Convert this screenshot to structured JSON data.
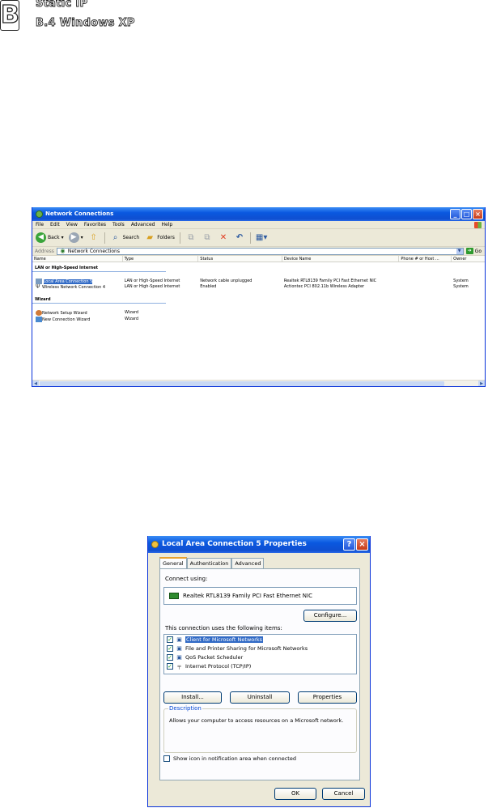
{
  "header": {
    "chapter_letter": "B",
    "title": "Static IP",
    "subtitle": "B.4 Windows XP"
  },
  "network_window": {
    "title": "Network Connections",
    "menu": [
      "File",
      "Edit",
      "View",
      "Favorites",
      "Tools",
      "Advanced",
      "Help"
    ],
    "toolbar": {
      "back": "Back",
      "search": "Search",
      "folders": "Folders"
    },
    "address_label": "Address",
    "address_value": "Network Connections",
    "go_label": "Go",
    "columns": [
      "Name",
      "Type",
      "Status",
      "Device Name",
      "Phone # or Host ...",
      "Owner"
    ],
    "groups": [
      {
        "title": "LAN or High-Speed Internet",
        "rows": [
          {
            "name": "Local Area Connection 5",
            "type": "LAN or High-Speed Internet",
            "status": "Network cable unplugged",
            "device": "Realtek RTL8139 Family PCI Fast Ethernet NIC",
            "phone": "",
            "owner": "System",
            "selected": true
          },
          {
            "name": "Wireless Network Connection 4",
            "type": "LAN or High-Speed Internet",
            "status": "Enabled",
            "device": "Actiontec PCI 802.11b Wireless Adapter",
            "phone": "",
            "owner": "System",
            "selected": false
          }
        ]
      },
      {
        "title": "Wizard",
        "rows": [
          {
            "name": "Network Setup Wizard",
            "type": "Wizard",
            "status": "",
            "device": "",
            "phone": "",
            "owner": "",
            "selected": false
          },
          {
            "name": "New Connection Wizard",
            "type": "Wizard",
            "status": "",
            "device": "",
            "phone": "",
            "owner": "",
            "selected": false
          }
        ]
      }
    ]
  },
  "properties_dialog": {
    "title": "Local Area Connection 5 Properties",
    "tabs": [
      "General",
      "Authentication",
      "Advanced"
    ],
    "active_tab": "General",
    "connect_using_label": "Connect using:",
    "adapter": "Realtek RTL8139 Family PCI Fast Ethernet NIC",
    "configure_button": "Configure...",
    "items_label": "This connection uses the following items:",
    "items": [
      {
        "label": "Client for Microsoft Networks",
        "checked": true,
        "selected": true,
        "icon": "network-client-icon"
      },
      {
        "label": "File and Printer Sharing for Microsoft Networks",
        "checked": true,
        "selected": false,
        "icon": "file-sharing-icon"
      },
      {
        "label": "QoS Packet Scheduler",
        "checked": true,
        "selected": false,
        "icon": "scheduler-icon"
      },
      {
        "label": "Internet Protocol (TCP/IP)",
        "checked": true,
        "selected": false,
        "icon": "protocol-icon"
      }
    ],
    "install_button": "Install...",
    "uninstall_button": "Uninstall",
    "properties_button": "Properties",
    "description_legend": "Description",
    "description_text": "Allows your computer to access resources on a Microsoft network.",
    "show_icon_label": "Show icon in notification area when connected",
    "show_icon_checked": false,
    "ok_button": "OK",
    "cancel_button": "Cancel"
  }
}
